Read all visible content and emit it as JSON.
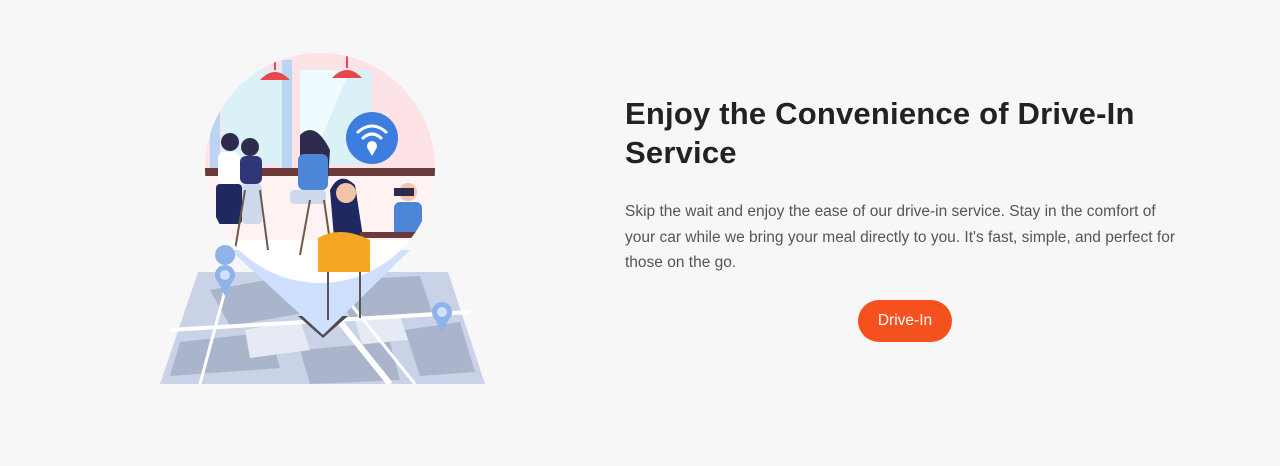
{
  "feature": {
    "title": "Enjoy the Convenience of Drive-In Service",
    "description": "Skip the wait and enjoy the ease of our drive-in service. Stay in the comfort of your car while we bring your meal directly to you. It's fast, simple, and perfect for those on the go.",
    "button_label": "Drive-In"
  },
  "colors": {
    "accent": "#f4511e",
    "title": "#222222",
    "text": "#555555",
    "background": "#f7f7f7"
  },
  "icons": [
    "wifi-location-icon",
    "map-pin-icon"
  ]
}
